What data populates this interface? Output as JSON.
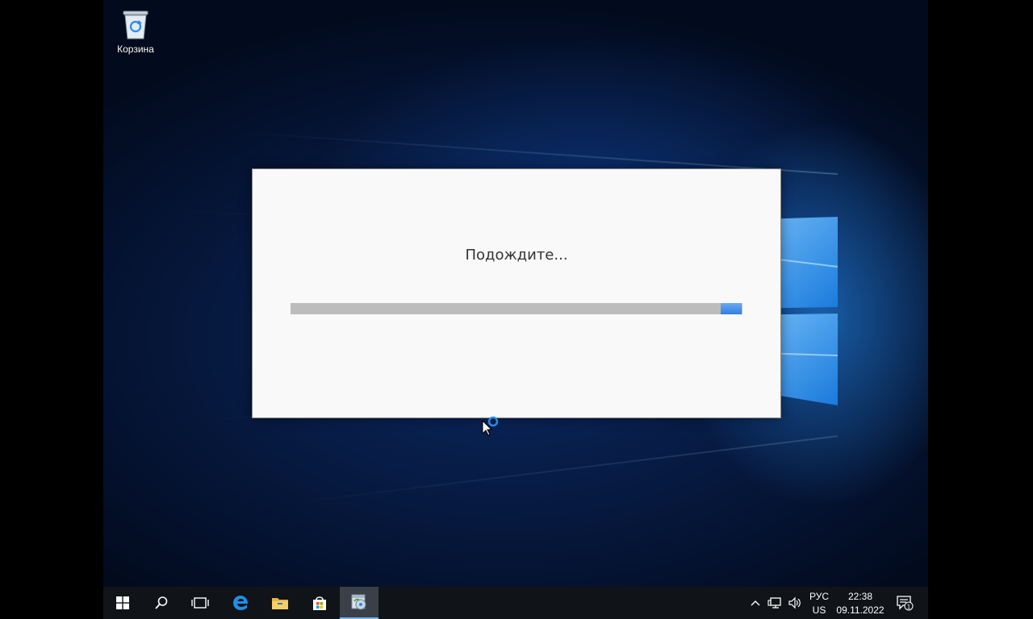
{
  "desktop": {
    "icons": [
      {
        "label": "Корзина",
        "icon": "recycle-bin-icon"
      }
    ]
  },
  "dialog": {
    "message": "Подождите...",
    "progress": {
      "state": "indeterminate"
    }
  },
  "taskbar": {
    "buttons": [
      {
        "icon": "windows-start-icon"
      },
      {
        "icon": "search-icon"
      },
      {
        "icon": "task-view-icon"
      },
      {
        "icon": "edge-browser-icon"
      },
      {
        "icon": "file-explorer-icon"
      },
      {
        "icon": "store-icon"
      },
      {
        "icon": "installer-app-icon",
        "active": true
      }
    ],
    "tray": {
      "language_top": "РУС",
      "language_bottom": "US",
      "time": "22:38",
      "date": "09.11.2022",
      "notification_count": "1"
    }
  },
  "colors": {
    "accent": "#2f7fe0",
    "taskbar": "#101318",
    "dialog_bg": "#f9f9f9"
  }
}
